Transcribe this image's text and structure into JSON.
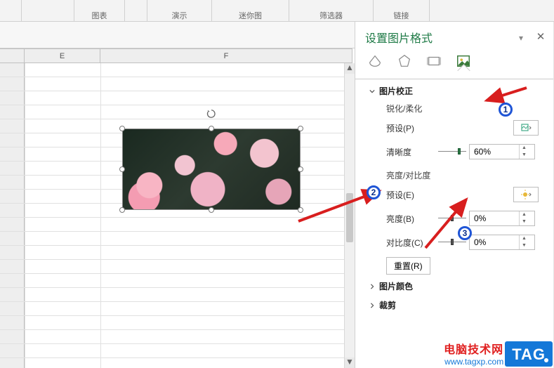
{
  "ribbon": {
    "group_chart": "图表",
    "group_demo": "演示",
    "group_spark": "迷你图",
    "group_filter": "筛选器",
    "group_link": "链接"
  },
  "grid": {
    "cols": {
      "e": "E",
      "f": "F"
    }
  },
  "pane": {
    "title": "设置图片格式",
    "sections": {
      "correction": {
        "title": "图片校正",
        "sharpen": "锐化/柔化",
        "preset_p": "预设(P)",
        "sharpness": "清晰度",
        "sharpness_val": "60%",
        "brightness_contrast": "亮度/对比度",
        "preset_e": "预设(E)",
        "brightness": "亮度(B)",
        "brightness_val": "0%",
        "contrast": "对比度(C)",
        "contrast_val": "0%",
        "reset": "重置(R)"
      },
      "color": "图片颜色",
      "crop": "裁剪"
    }
  },
  "watermark": {
    "line1": "电脑技术网",
    "line2": "www.tagxp.com",
    "tag": "TAG"
  },
  "badges": {
    "b1": "1",
    "b2": "2",
    "b3": "3"
  }
}
